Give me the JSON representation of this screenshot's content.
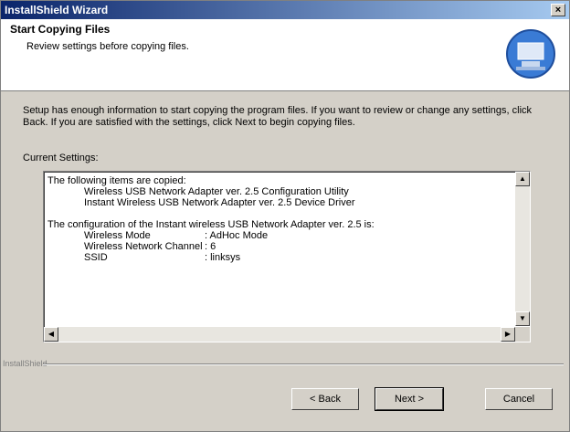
{
  "window": {
    "title": "InstallShield Wizard",
    "close": "×"
  },
  "header": {
    "title": "Start Copying Files",
    "subtitle": "Review settings before copying files."
  },
  "intro": "Setup has enough information to start copying the program files. If you want to review or change any settings, click Back. If you are satisfied with the settings, click Next to begin copying files.",
  "current_settings_label": "Current Settings:",
  "settings_text": {
    "copied_heading": "The following items are copied:",
    "copied_items": [
      "Wireless USB Network Adapter ver. 2.5 Configuration Utility",
      "Instant Wireless USB Network Adapter ver. 2.5 Device Driver"
    ],
    "config_heading": "The configuration of the Instant wireless USB Network Adapter ver. 2.5 is:",
    "config": [
      {
        "k": "Wireless Mode",
        "v": ": AdHoc Mode"
      },
      {
        "k": "Wireless Network Channel",
        "v": ": 6"
      },
      {
        "k": "SSID",
        "v": ": linksys"
      }
    ]
  },
  "footer_brand": "InstallShield",
  "buttons": {
    "back": "< Back",
    "next": "Next >",
    "cancel": "Cancel"
  },
  "icons": {
    "installer": "installer-computer-icon"
  },
  "colors": {
    "titlebar_start": "#0a246a",
    "titlebar_end": "#a6caf0"
  }
}
